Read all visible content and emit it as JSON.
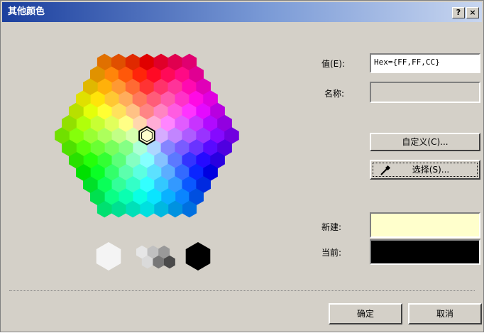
{
  "dialog": {
    "title": "其他颜色",
    "help_label": "?",
    "close_label": "×"
  },
  "form": {
    "value_label": "值(E):",
    "value_text": "Hex={FF,FF,CC}",
    "name_label": "名称:",
    "name_value": "",
    "custom_button": "自定义(C)...",
    "select_button": "选择(S)...",
    "new_label": "新建:",
    "current_label": "当前:",
    "ok_button": "确定",
    "cancel_button": "取消"
  },
  "colors": {
    "new": "#ffffcc",
    "current": "#000000",
    "selected": "#ffffcc"
  },
  "icons": {
    "eyedropper": "eyedropper-icon"
  }
}
